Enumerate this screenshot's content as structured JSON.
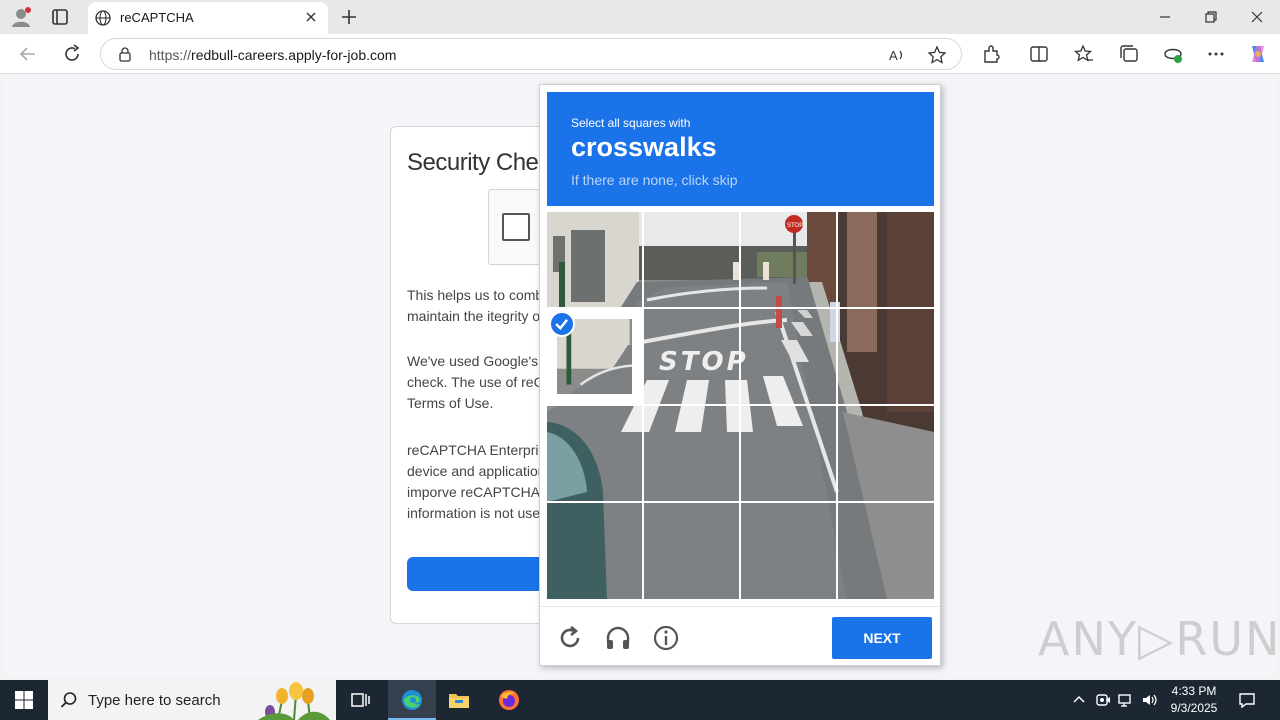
{
  "browser": {
    "tab_title": "reCAPTCHA",
    "url_scheme": "https://",
    "url_host": "redbull-careers.apply-for-job.com"
  },
  "page": {
    "heading": "Security Chec",
    "para1_line1": "This helps us to comba",
    "para1_line2": "maintain the itegrity of",
    "para2_line1": "We've used Google's r",
    "para2_line2": "check. The use of reCA",
    "para2_line3": "Terms of Use.",
    "para3_line1": "reCAPTCHA Enterpris",
    "para3_line2": "device and application",
    "para3_line3": "imporve reCAPTCHA",
    "para3_line4": "information is not used"
  },
  "captcha": {
    "instruction": "Select all squares with",
    "target": "crosswalks",
    "hint": "If there are none, click skip",
    "next_label": "NEXT",
    "road_text": "STOP",
    "sign_text": "STOP",
    "grid_rows": 4,
    "grid_cols": 4,
    "selected_tiles": [
      [
        1,
        0
      ]
    ]
  },
  "watermark": "ANY▷RUN",
  "taskbar": {
    "search_placeholder": "Type here to search",
    "time": "4:33 PM",
    "date": "9/3/2025"
  },
  "colors": {
    "accent": "#1a73e8",
    "taskbar": "#1c2733"
  }
}
